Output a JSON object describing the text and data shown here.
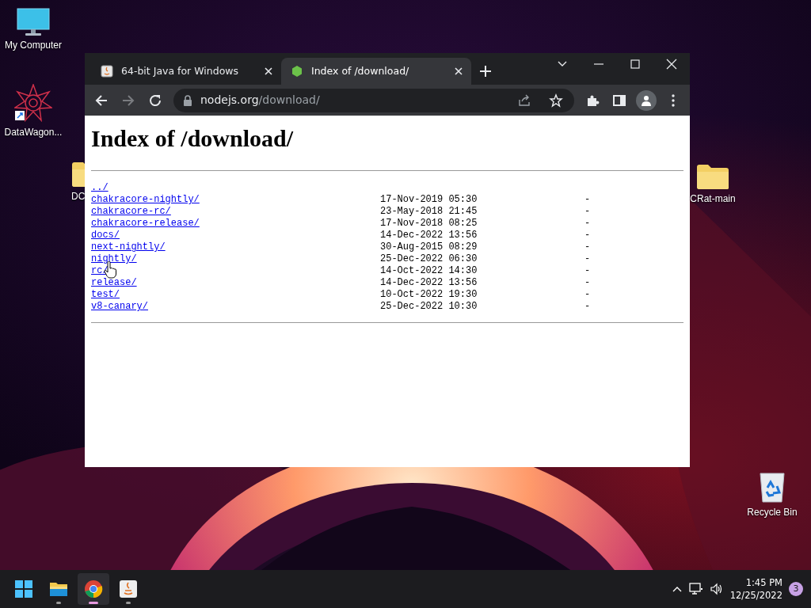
{
  "desktop_icons": [
    {
      "label": "My Computer",
      "kind": "monitor"
    },
    {
      "label": "DataWagon...",
      "kind": "shortcut"
    },
    {
      "label": "DC",
      "kind": "folder"
    },
    {
      "label": "CRat-main",
      "kind": "folder"
    },
    {
      "label": "Recycle Bin",
      "kind": "recycle"
    }
  ],
  "browser": {
    "tabs": [
      {
        "title": "64-bit Java for Windows",
        "selected": false,
        "kind": "java"
      },
      {
        "title": "Index of /download/",
        "selected": true,
        "kind": "node"
      }
    ],
    "address": {
      "host": "nodejs.org",
      "path": "/download/"
    },
    "page": {
      "heading": "Index of /download/",
      "entries": [
        {
          "name": "../"
        },
        {
          "name": "chakracore-nightly/",
          "date": "17-Nov-2019 05:30",
          "size": "-"
        },
        {
          "name": "chakracore-rc/",
          "date": "23-May-2018 21:45",
          "size": "-"
        },
        {
          "name": "chakracore-release/",
          "date": "17-Nov-2018 08:25",
          "size": "-"
        },
        {
          "name": "docs/",
          "date": "14-Dec-2022 13:56",
          "size": "-"
        },
        {
          "name": "next-nightly/",
          "date": "30-Aug-2015 08:29",
          "size": "-"
        },
        {
          "name": "nightly/",
          "date": "25-Dec-2022 06:30",
          "size": "-"
        },
        {
          "name": "rc/",
          "date": "14-Oct-2022 14:30",
          "size": "-"
        },
        {
          "name": "release/",
          "date": "14-Dec-2022 13:56",
          "size": "-"
        },
        {
          "name": "test/",
          "date": "10-Oct-2022 19:30",
          "size": "-"
        },
        {
          "name": "v8-canary/",
          "date": "25-Dec-2022 10:30",
          "size": "-"
        }
      ]
    }
  },
  "taskbar": {
    "apps": [
      {
        "kind": "start",
        "selected": false
      },
      {
        "kind": "explorer",
        "selected": false
      },
      {
        "kind": "chrome",
        "selected": true
      },
      {
        "kind": "java",
        "selected": false
      }
    ],
    "clock": {
      "time": "1:45 PM",
      "date": "12/25/2022"
    },
    "notification_count": "3"
  }
}
